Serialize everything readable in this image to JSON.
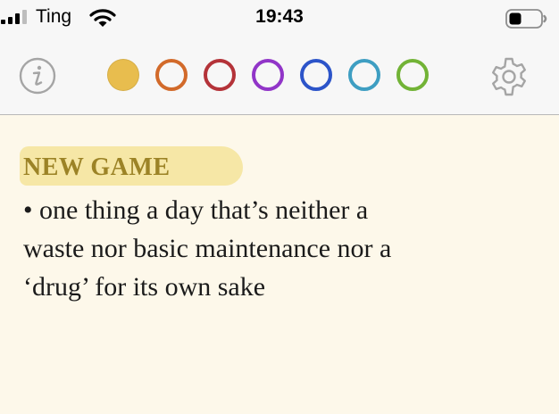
{
  "status_bar": {
    "carrier": "Ting",
    "time": "19:43"
  },
  "toolbar": {
    "info_icon": "info-icon",
    "settings_icon": "gear-icon",
    "colors": [
      {
        "name": "yellow",
        "color": "#e8bd4e",
        "selected": true
      },
      {
        "name": "orange",
        "color": "#d26a2a",
        "selected": false
      },
      {
        "name": "red",
        "color": "#b43339",
        "selected": false
      },
      {
        "name": "purple",
        "color": "#9135c8",
        "selected": false
      },
      {
        "name": "blue",
        "color": "#2c54c9",
        "selected": false
      },
      {
        "name": "teal",
        "color": "#3e9ec2",
        "selected": false
      },
      {
        "name": "green",
        "color": "#72b336",
        "selected": false
      }
    ]
  },
  "note": {
    "title": "NEW GAME",
    "lines": [
      "• one thing a day that’s neither a",
      "waste nor basic maintenance nor a",
      "‘drug’ for its own sake"
    ],
    "title_color": "#9c8326",
    "highlight_color": "#f3e18f"
  }
}
